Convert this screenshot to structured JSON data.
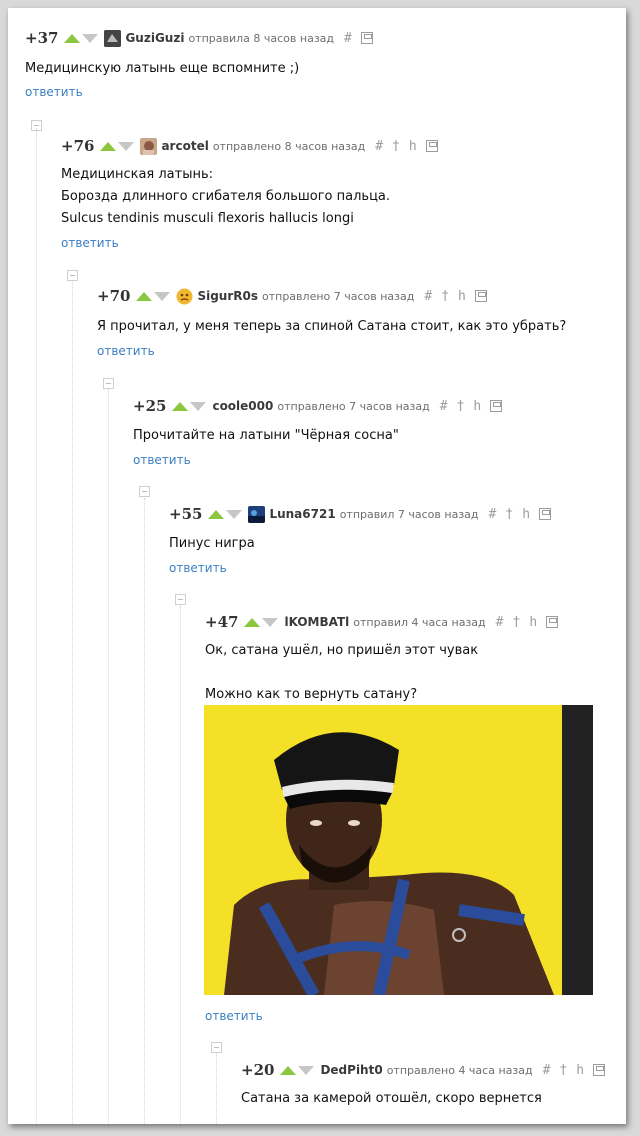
{
  "comments": [
    {
      "rating": "+37",
      "username": "GuziGuzi",
      "meta": "отправила 8 часов назад",
      "lines": [
        "Медицинскую латынь еще вспомните ;)"
      ],
      "reply": "ответить",
      "tools": [
        "#"
      ]
    },
    {
      "rating": "+76",
      "username": "arcotel",
      "meta": "отправлено 8 часов назад",
      "lines": [
        "Медицинская латынь:",
        "Борозда длинного сгибателя большого пальца.",
        "Sulcus tendinis musculi flexoris hallucis longi"
      ],
      "reply": "ответить",
      "tools": [
        "#",
        "†",
        "h"
      ]
    },
    {
      "rating": "+70",
      "username": "SigurR0s",
      "meta": "отправлено 7 часов назад",
      "lines": [
        "Я прочитал, у меня теперь за спиной Сатана стоит, как это убрать?"
      ],
      "reply": "ответить",
      "tools": [
        "#",
        "†",
        "h"
      ]
    },
    {
      "rating": "+25",
      "username": "coole000",
      "meta": "отправлено 7 часов назад",
      "lines": [
        "Прочитайте на латыни \"Чёрная сосна\""
      ],
      "reply": "ответить",
      "tools": [
        "#",
        "†",
        "h"
      ]
    },
    {
      "rating": "+55",
      "username": "Luna6721",
      "meta": "отправил 7 часов назад",
      "lines": [
        "Пинус нигра"
      ],
      "reply": "ответить",
      "tools": [
        "#",
        "†",
        "h"
      ]
    },
    {
      "rating": "+47",
      "username": "lKOMBATl",
      "meta": "отправил 4 часа назад",
      "lines": [
        "Ок, сатана ушёл, но пришёл этот чувак",
        "",
        "Можно как то вернуть сатану?"
      ],
      "reply": "ответить",
      "tools": [
        "#",
        "†",
        "h"
      ]
    },
    {
      "rating": "+20",
      "username": "DedPiht0",
      "meta": "отправлено 4 часа назад",
      "lines": [
        "Сатана за камерой отошёл, скоро вернется"
      ],
      "reply": "",
      "tools": [
        "#",
        "†",
        "h"
      ]
    }
  ],
  "colors": {
    "upvote": "#8cc63f",
    "downvote": "#c6c6c6",
    "link": "#3b7fc4",
    "photo_bg": "#f4e127"
  }
}
